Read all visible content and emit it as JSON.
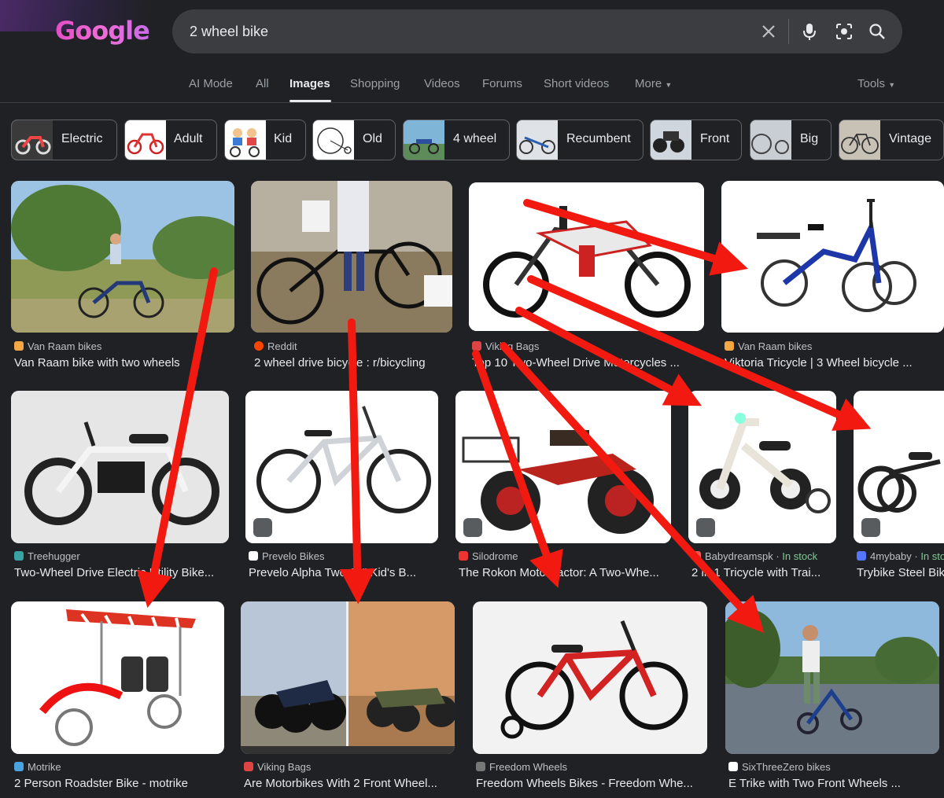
{
  "logo": {
    "text": "Google"
  },
  "search": {
    "query": "2 wheel bike"
  },
  "nav": {
    "tabs": [
      "AI Mode",
      "All",
      "Images",
      "Shopping",
      "Videos",
      "Forums",
      "Short videos",
      "More"
    ],
    "tools": "Tools"
  },
  "chips": [
    "Electric",
    "Adult",
    "Kid",
    "Old",
    "4 wheel",
    "Recumbent",
    "Front",
    "Big",
    "Vintage"
  ],
  "results": {
    "row1": [
      {
        "source": "Van Raam bikes",
        "title": "Van Raam bike with two wheels"
      },
      {
        "source": "Reddit",
        "title": "2 wheel drive bicycle : r/bicycling"
      },
      {
        "source": "Viking Bags",
        "title": "Top 10 Two-Wheel Drive Motorcycles ..."
      },
      {
        "source": "Van Raam bikes",
        "title": "Viktoria Tricycle | 3 Wheel bicycle ..."
      }
    ],
    "row2": [
      {
        "source": "Treehugger",
        "title": "Two-Wheel Drive Electric Utility Bike..."
      },
      {
        "source": "Prevelo Bikes",
        "title": "Prevelo Alpha Two 16\" Kid's B..."
      },
      {
        "source": "Silodrome",
        "title": "The Rokon Motortractor: A Two-Whe..."
      },
      {
        "source": "Babydreamspk",
        "stock": "In stock",
        "title": "2 in 1 Tricycle with Trai..."
      },
      {
        "source": "4mybaby",
        "stock": "In stock",
        "title": "Trybike Steel Bike"
      }
    ],
    "row3": [
      {
        "source": "Motrike",
        "title": "2 Person Roadster Bike - motrike"
      },
      {
        "source": "Viking Bags",
        "title": "Are Motorbikes With 2 Front Wheel..."
      },
      {
        "source": "Freedom Wheels",
        "title": "Freedom Wheels Bikes - Freedom Whe..."
      },
      {
        "source": "SixThreeZero bikes",
        "title": "E Trike with Two Front Wheels ..."
      }
    ]
  },
  "colors": {
    "annotation_arrow": "#f21a10",
    "background": "#202124",
    "search_bar": "#3c3d41"
  }
}
